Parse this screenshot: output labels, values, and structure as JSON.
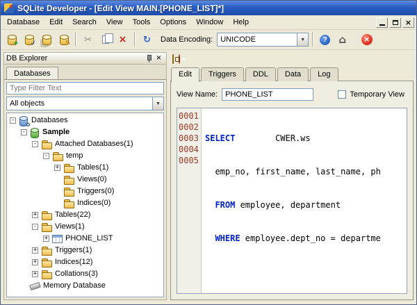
{
  "window": {
    "title": "SQLite Developer - [Edit View MAIN.[PHONE_LIST]*]"
  },
  "menu": {
    "items": [
      "Database",
      "Edit",
      "Search",
      "View",
      "Tools",
      "Options",
      "Window",
      "Help"
    ]
  },
  "toolbar": {
    "data_encoding_label": "Data Encoding:",
    "data_encoding_value": "UNICODE",
    "icons": [
      "new-database-icon",
      "register-database-icon",
      "attach-database-icon",
      "edit-database-icon",
      "cut-icon",
      "copy-icon",
      "delete-icon",
      "refresh-icon",
      "help-icon",
      "home-icon",
      "stop-icon"
    ]
  },
  "explorer": {
    "title": "DB Explorer",
    "tab_label": "Databases",
    "filter_placeholder": "Type Filter Text",
    "scope_value": "All objects",
    "tree": [
      {
        "label": "Databases",
        "level": 0,
        "expander": "-",
        "icon": "database-search"
      },
      {
        "label": "Sample",
        "level": 1,
        "expander": "-",
        "icon": "database-green",
        "bold": true
      },
      {
        "label": "Attached Databases(1)",
        "level": 2,
        "expander": "-",
        "icon": "folder"
      },
      {
        "label": "temp",
        "level": 3,
        "expander": "-",
        "icon": "folder"
      },
      {
        "label": "Tables(1)",
        "level": 4,
        "expander": "+",
        "icon": "folder"
      },
      {
        "label": "Views(0)",
        "level": 4,
        "expander": "",
        "icon": "folder"
      },
      {
        "label": "Triggers(0)",
        "level": 4,
        "expander": "",
        "icon": "folder"
      },
      {
        "label": "Indices(0)",
        "level": 4,
        "expander": "",
        "icon": "folder"
      },
      {
        "label": "Tables(22)",
        "level": 2,
        "expander": "+",
        "icon": "folder"
      },
      {
        "label": "Views(1)",
        "level": 2,
        "expander": "-",
        "icon": "folder"
      },
      {
        "label": "PHONE_LIST",
        "level": 3,
        "expander": "+",
        "icon": "table-grid"
      },
      {
        "label": "Triggers(1)",
        "level": 2,
        "expander": "+",
        "icon": "folder"
      },
      {
        "label": "Indices(12)",
        "level": 2,
        "expander": "+",
        "icon": "folder"
      },
      {
        "label": "Collations(3)",
        "level": 2,
        "expander": "+",
        "icon": "folder"
      },
      {
        "label": "Memory Database",
        "level": 1,
        "expander": "",
        "icon": "memory"
      }
    ]
  },
  "editor": {
    "tabs": [
      "Edit",
      "Triggers",
      "DDL",
      "Data",
      "Log"
    ],
    "active_tab": "Edit",
    "view_name_label": "View Name:",
    "view_name_value": "PHONE_LIST",
    "temporary_view_label": "Temporary View",
    "code": {
      "lines": [
        {
          "num": "0001",
          "segments": [
            {
              "type": "keyword",
              "text": "SELECT"
            },
            {
              "type": "plain",
              "text": "        CWER.ws"
            }
          ]
        },
        {
          "num": "0002",
          "segments": [
            {
              "type": "plain",
              "text": "  emp_no, first_name, last_name, ph"
            }
          ]
        },
        {
          "num": "0003",
          "segments": [
            {
              "type": "plain",
              "text": "  "
            },
            {
              "type": "keyword",
              "text": "FROM"
            },
            {
              "type": "plain",
              "text": " employee, department"
            }
          ]
        },
        {
          "num": "0004",
          "segments": [
            {
              "type": "plain",
              "text": "  "
            },
            {
              "type": "keyword",
              "text": "WHERE"
            },
            {
              "type": "plain",
              "text": " employee.dept_no = departme"
            }
          ]
        },
        {
          "num": "0005",
          "segments": []
        }
      ]
    }
  }
}
